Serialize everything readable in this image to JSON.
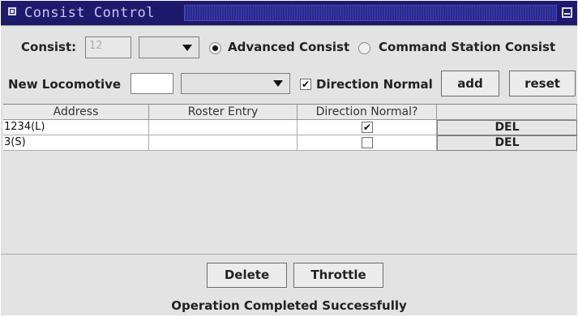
{
  "window": {
    "title": "Consist Control"
  },
  "consist": {
    "label": "Consist:",
    "address_value": "12",
    "type_options": [
      "Advanced Consist",
      "Command Station Consist"
    ],
    "selected_type": "Advanced Consist"
  },
  "locomotive": {
    "label": "New Locomotive",
    "address_value": "",
    "roster_value": "",
    "direction_label": "Direction Normal",
    "direction_checked": true,
    "add_label": "add",
    "reset_label": "reset"
  },
  "table": {
    "columns": [
      "Address",
      "Roster Entry",
      "Direction Normal?",
      ""
    ],
    "rows": [
      {
        "address": "1234(L)",
        "roster": "",
        "direction_normal": true,
        "action": "DEL"
      },
      {
        "address": "3(S)",
        "roster": "",
        "direction_normal": false,
        "action": "DEL"
      }
    ]
  },
  "footer": {
    "delete_label": "Delete",
    "throttle_label": "Throttle",
    "status": "Operation Completed Successfully"
  },
  "colors": {
    "titlebar": "#1e1a6b",
    "title_text": "#c9c6f2",
    "window_bg": "#e3e3e3"
  }
}
